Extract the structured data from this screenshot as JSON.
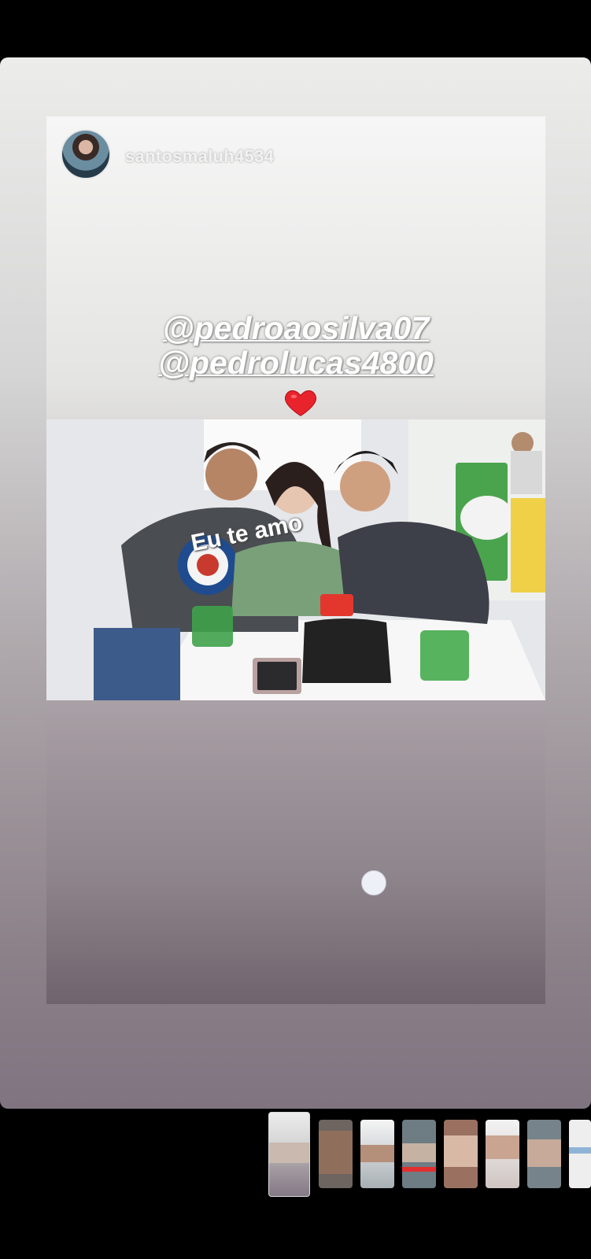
{
  "story": {
    "username": "santosmaluh4534",
    "mentions": [
      "@pedroaosilva07",
      "@pedrolucas4800"
    ],
    "sticker_text": "Eu te amo"
  },
  "colors": {
    "background": "#000000",
    "heart": "#e8232b",
    "accent_green": "#41a649"
  },
  "thumbnails": [
    {
      "index": 0,
      "active": true
    },
    {
      "index": 1,
      "active": false
    },
    {
      "index": 2,
      "active": false
    },
    {
      "index": 3,
      "active": false
    },
    {
      "index": 4,
      "active": false
    },
    {
      "index": 5,
      "active": false
    },
    {
      "index": 6,
      "active": false
    },
    {
      "index": 7,
      "active": false
    }
  ]
}
